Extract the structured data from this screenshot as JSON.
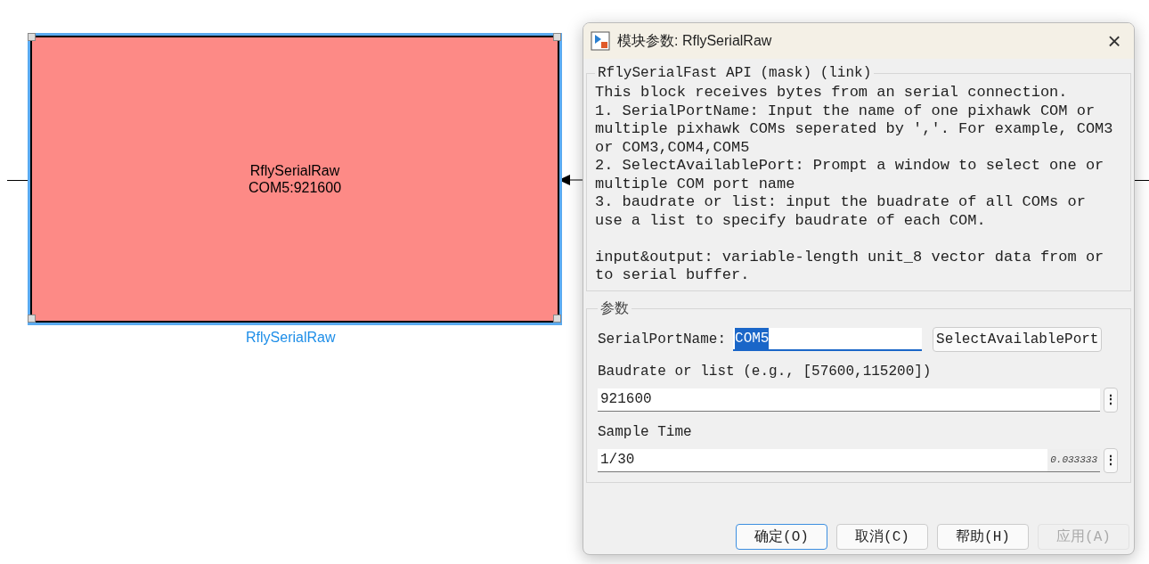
{
  "canvas": {
    "block": {
      "text_lines": [
        "RflySerialRaw",
        "COM5:921600"
      ],
      "caption": "RflySerialRaw",
      "selected": true
    }
  },
  "dialog": {
    "title": "模块参数: RflySerialRaw",
    "close": "×",
    "description_group": {
      "title": "RflySerialFast API (mask) (link)",
      "paragraphs": [
        "This block receives bytes from an serial connection.",
        "1. SerialPortName: Input the name of one pixhawk COM or multiple pixhawk COMs seperated by ','. For example, COM3 or COM3,COM4,COM5",
        "2. SelectAvailablePort: Prompt a window to select one or multiple COM port name",
        "3. baudrate or list: input the buadrate of all COMs or use a list to specify baudrate of each COM.",
        "input&output: variable-length unit_8 vector data from or to serial buffer."
      ]
    },
    "params_group": {
      "title": "参数",
      "serial_port": {
        "label": "SerialPortName:",
        "value": "COM5",
        "button": "SelectAvailablePort"
      },
      "baudrate": {
        "label": "Baudrate or list (e.g., [57600,115200])",
        "value": "921600",
        "menu": "⋮"
      },
      "sample_time": {
        "label": "Sample Time",
        "value": "1/30",
        "evaluated": "0.033333",
        "menu": "⋮"
      }
    },
    "buttons": [
      {
        "label": "确定(O)",
        "focused": true,
        "disabled": false
      },
      {
        "label": "取消(C)",
        "focused": false,
        "disabled": false
      },
      {
        "label": "帮助(H)",
        "focused": false,
        "disabled": false
      },
      {
        "label": "应用(A)",
        "focused": false,
        "disabled": true
      }
    ]
  }
}
